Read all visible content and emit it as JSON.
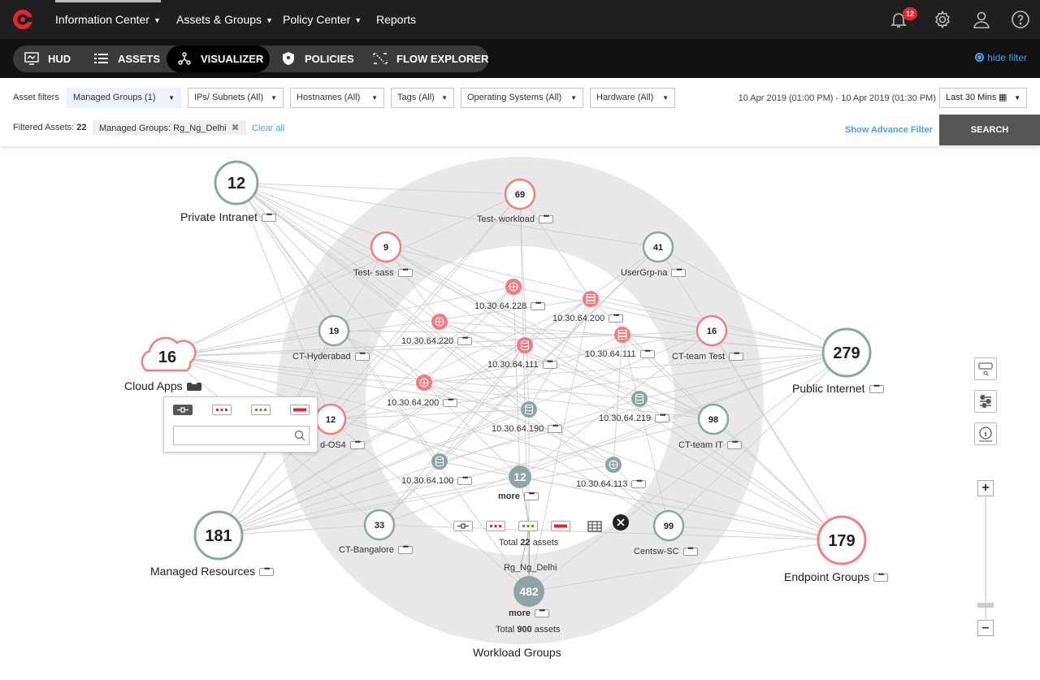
{
  "nav": {
    "items": [
      {
        "label": "Information Center",
        "caret": true
      },
      {
        "label": "Assets & Groups",
        "caret": true
      },
      {
        "label": "Policy Center",
        "caret": true
      },
      {
        "label": "Reports",
        "caret": false
      }
    ],
    "notification_count": "12",
    "icons": [
      "bell-icon",
      "gear-icon",
      "user-icon",
      "help-icon"
    ]
  },
  "tabs": {
    "items": [
      "HUD",
      "ASSETS",
      "VISUALIZER",
      "POLICIES",
      "FLOW EXPLORER"
    ],
    "active": "VISUALIZER"
  },
  "hide_filter": "hide filter",
  "filters": {
    "label": "Asset filters",
    "selects": [
      "Managed Groups (1)",
      "IPs/ Subnets (All)",
      "Hostnames (All)",
      "Tags (All)",
      "Operating Systems (All)",
      "Hardware (All)"
    ],
    "date_range": "10 Apr 2019 (01:00 PM) - 10 Apr 2019 (01:30 PM)",
    "time_window": "Last 30 Mins",
    "filtered_label": "Filtered Assets:",
    "filtered_count": "22",
    "chip": "Managed Groups: Rg_Ng_Delhi",
    "clear_all": "Clear all",
    "advance_filter": "Show Advance Filter",
    "search": "SEARCH"
  },
  "graph": {
    "outer_nodes": [
      {
        "count": "12",
        "label": "Private Intranet"
      },
      {
        "count": "16",
        "label": "Cloud Apps"
      },
      {
        "count": "181",
        "label": "Managed Resources"
      },
      {
        "count": "279",
        "label": "Public Internet"
      },
      {
        "count": "179",
        "label": "Endpoint Groups"
      }
    ],
    "ring_label": "Workload Groups",
    "group_nodes": [
      {
        "count": "69",
        "label": "Test- workload",
        "status": "alert"
      },
      {
        "count": "9",
        "label": "Test- sass",
        "status": "alert"
      },
      {
        "count": "41",
        "label": "UserGrp-na",
        "status": "normal"
      },
      {
        "count": "19",
        "label": "CT-Hyderabad",
        "status": "normal"
      },
      {
        "count": "16",
        "label": "CT-team Test",
        "status": "alert"
      },
      {
        "count": "12",
        "label": "d-OS4",
        "status": "alert"
      },
      {
        "count": "98",
        "label": "CT-team IT",
        "status": "normal"
      },
      {
        "count": "33",
        "label": "CT-Bangalore",
        "status": "normal"
      },
      {
        "count": "99",
        "label": "Centsw-SC",
        "status": "normal"
      }
    ],
    "ip_nodes": [
      {
        "label": "10.30.64.228",
        "icon": "globe-icon",
        "status": "alert"
      },
      {
        "label": "10.30.64.200",
        "icon": "server-icon",
        "status": "alert"
      },
      {
        "label": "10.30.64.220",
        "icon": "globe-icon",
        "status": "alert"
      },
      {
        "label": "10.30.64.111",
        "icon": "database-icon",
        "status": "alert"
      },
      {
        "label": "10.30.64.111",
        "icon": "server-icon",
        "status": "alert"
      },
      {
        "label": "10.30.64.200",
        "icon": "globe-icon",
        "status": "alert"
      },
      {
        "label": "10.30.64.190",
        "icon": "database-icon",
        "status": "normal"
      },
      {
        "label": "10.30.64.219",
        "icon": "database-icon",
        "status": "normal"
      },
      {
        "label": "10.30.64.100",
        "icon": "database-icon",
        "status": "normal"
      },
      {
        "label": "10.30.64.113",
        "icon": "globe-icon",
        "status": "normal"
      }
    ],
    "more_inner": {
      "count": "12",
      "label": "more"
    },
    "more_outer": {
      "count": "482",
      "label": "more"
    },
    "total_inner": {
      "prefix": "Total",
      "count": "22",
      "suffix": "assets"
    },
    "total_outer": {
      "prefix": "Total",
      "count": "900",
      "suffix": "assets"
    },
    "selected_group": "Rg_Ng_Delhi"
  },
  "colors": {
    "alert": "#f07f84",
    "normal": "#8fa5a5",
    "alert_fill": "#f37a80",
    "normal_fill": "#8fa5a5",
    "accent": "#4aa3e8"
  }
}
